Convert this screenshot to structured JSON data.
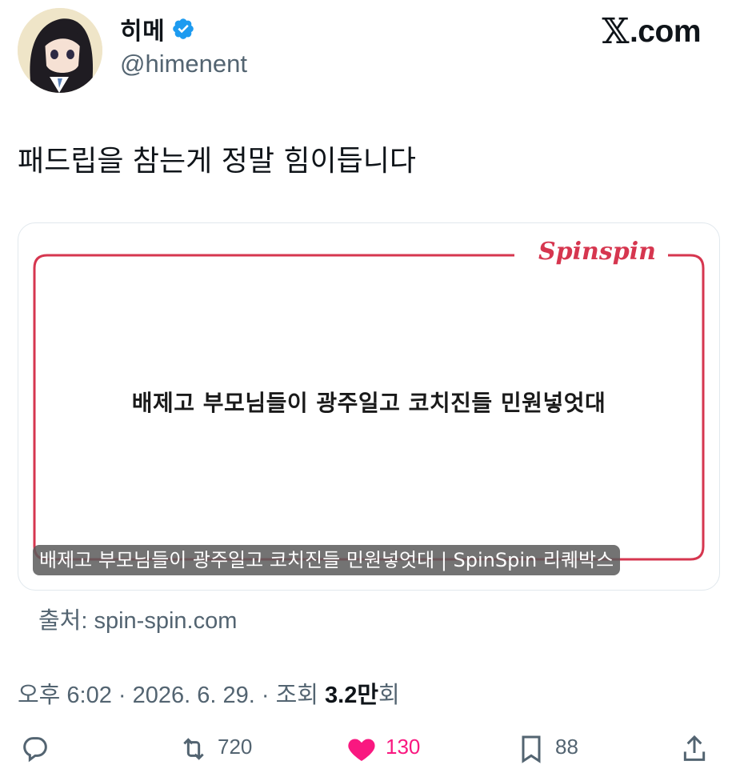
{
  "user": {
    "display_name": "히메",
    "handle": "@himenent"
  },
  "brand": {
    "x_mark": "𝕏",
    "label": ".com"
  },
  "tweet": {
    "text": "패드립을 참는게 정말 힘이듭니다"
  },
  "link_card": {
    "logo_text": "Spinspin",
    "headline": "배제고 부모님들이 광주일고 코치진들 민원넣엇대",
    "caption": "배제고 부모님들이 광주일고 코치진들 민원넣엇대 | SpinSpin 리퀘박스",
    "frame_color": "#d6364f"
  },
  "source": {
    "label": "출처: spin-spin.com"
  },
  "meta": {
    "time_date": "오후 6:02 · 2026. 6. 29. · 조회 ",
    "views": "3.2만",
    "views_suffix": "회"
  },
  "actions": {
    "reply_icon": "reply-icon",
    "retweet_icon": "retweet-icon",
    "retweet_count": "720",
    "like_icon": "heart-icon",
    "like_count": "130",
    "like_color": "#f91880",
    "bookmark_icon": "bookmark-icon",
    "bookmark_count": "88",
    "share_icon": "share-icon"
  },
  "colors": {
    "verified": "#1d9bf0",
    "secondary_text": "#536471"
  }
}
